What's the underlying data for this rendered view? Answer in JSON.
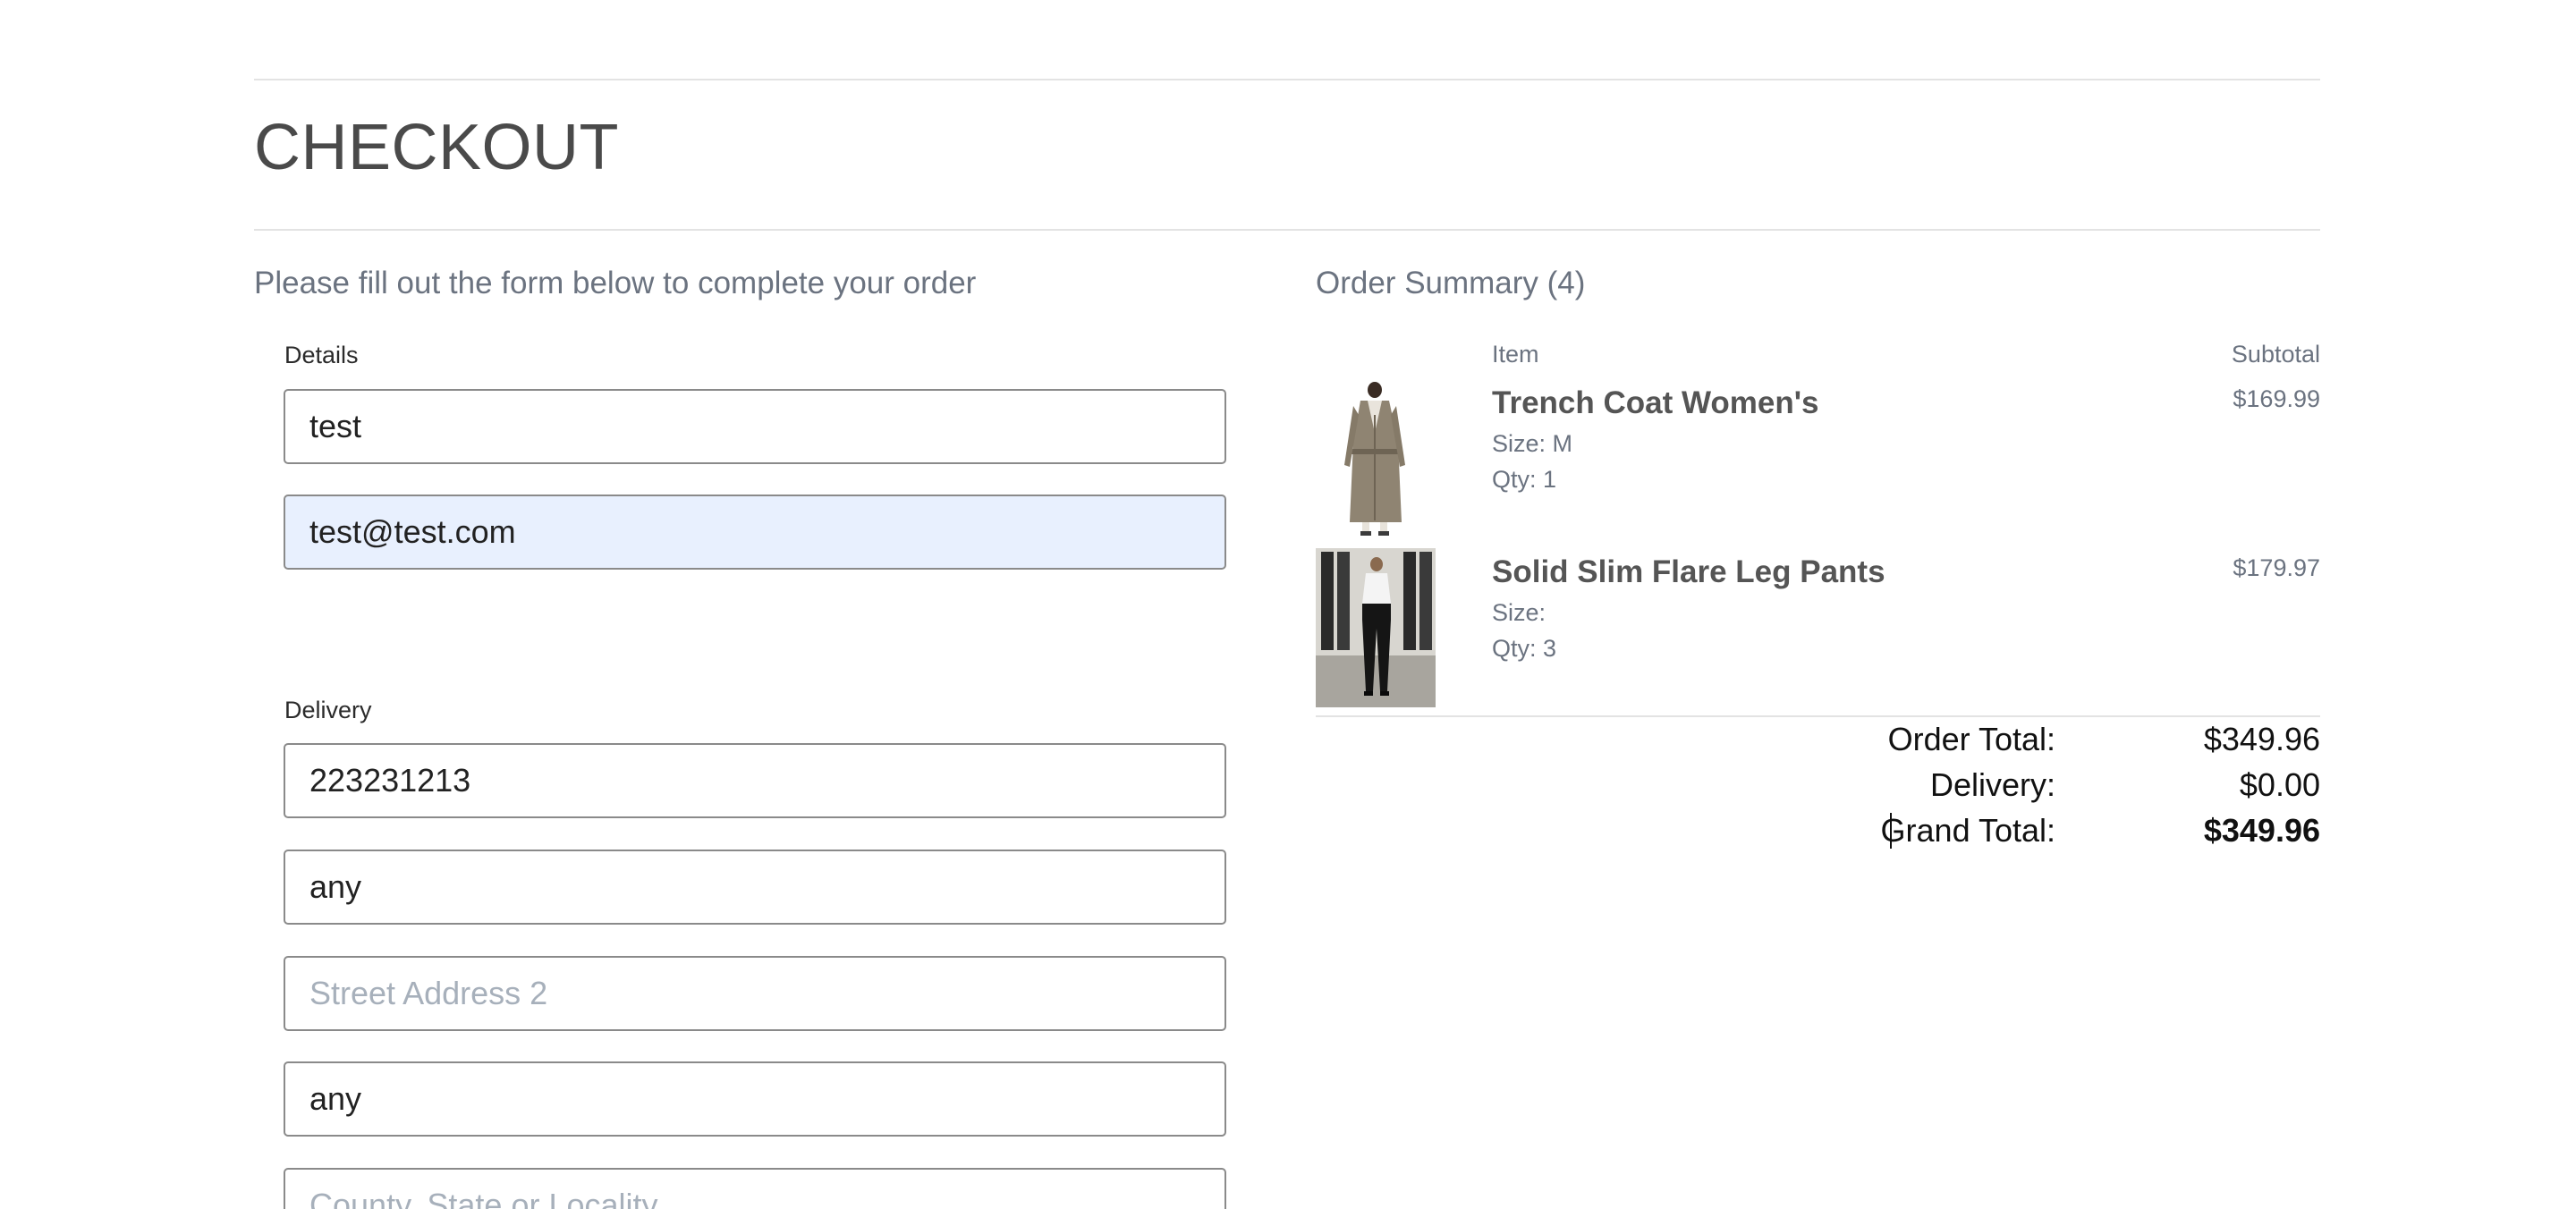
{
  "page": {
    "title": "CHECKOUT",
    "intro": "Please fill out the form below to complete your order"
  },
  "details": {
    "label": "Details",
    "name_value": "test",
    "email_value": "test@test.com"
  },
  "delivery": {
    "label": "Delivery",
    "phone_value": "223231213",
    "street1_value": "any",
    "street2_placeholder": "Street Address 2",
    "city_value": "any",
    "county_placeholder": "County, State or Locality"
  },
  "summary": {
    "title": "Order Summary (4)",
    "col_item": "Item",
    "col_subtotal": "Subtotal",
    "items": [
      {
        "name": "Trench Coat Women's",
        "size": "Size: M",
        "qty": "Qty: 1",
        "price": "$169.99",
        "image": "trench-coat-photo"
      },
      {
        "name": "Solid Slim Flare Leg Pants",
        "size": "Size:",
        "qty": "Qty: 3",
        "price": "$179.97",
        "image": "flare-pants-photo"
      }
    ],
    "order_total_label": "Order Total:",
    "order_total_value": "$349.96",
    "delivery_label": "Delivery:",
    "delivery_value": "$0.00",
    "grand_total_label": "Grand Total:",
    "grand_total_value": "$349.96"
  }
}
